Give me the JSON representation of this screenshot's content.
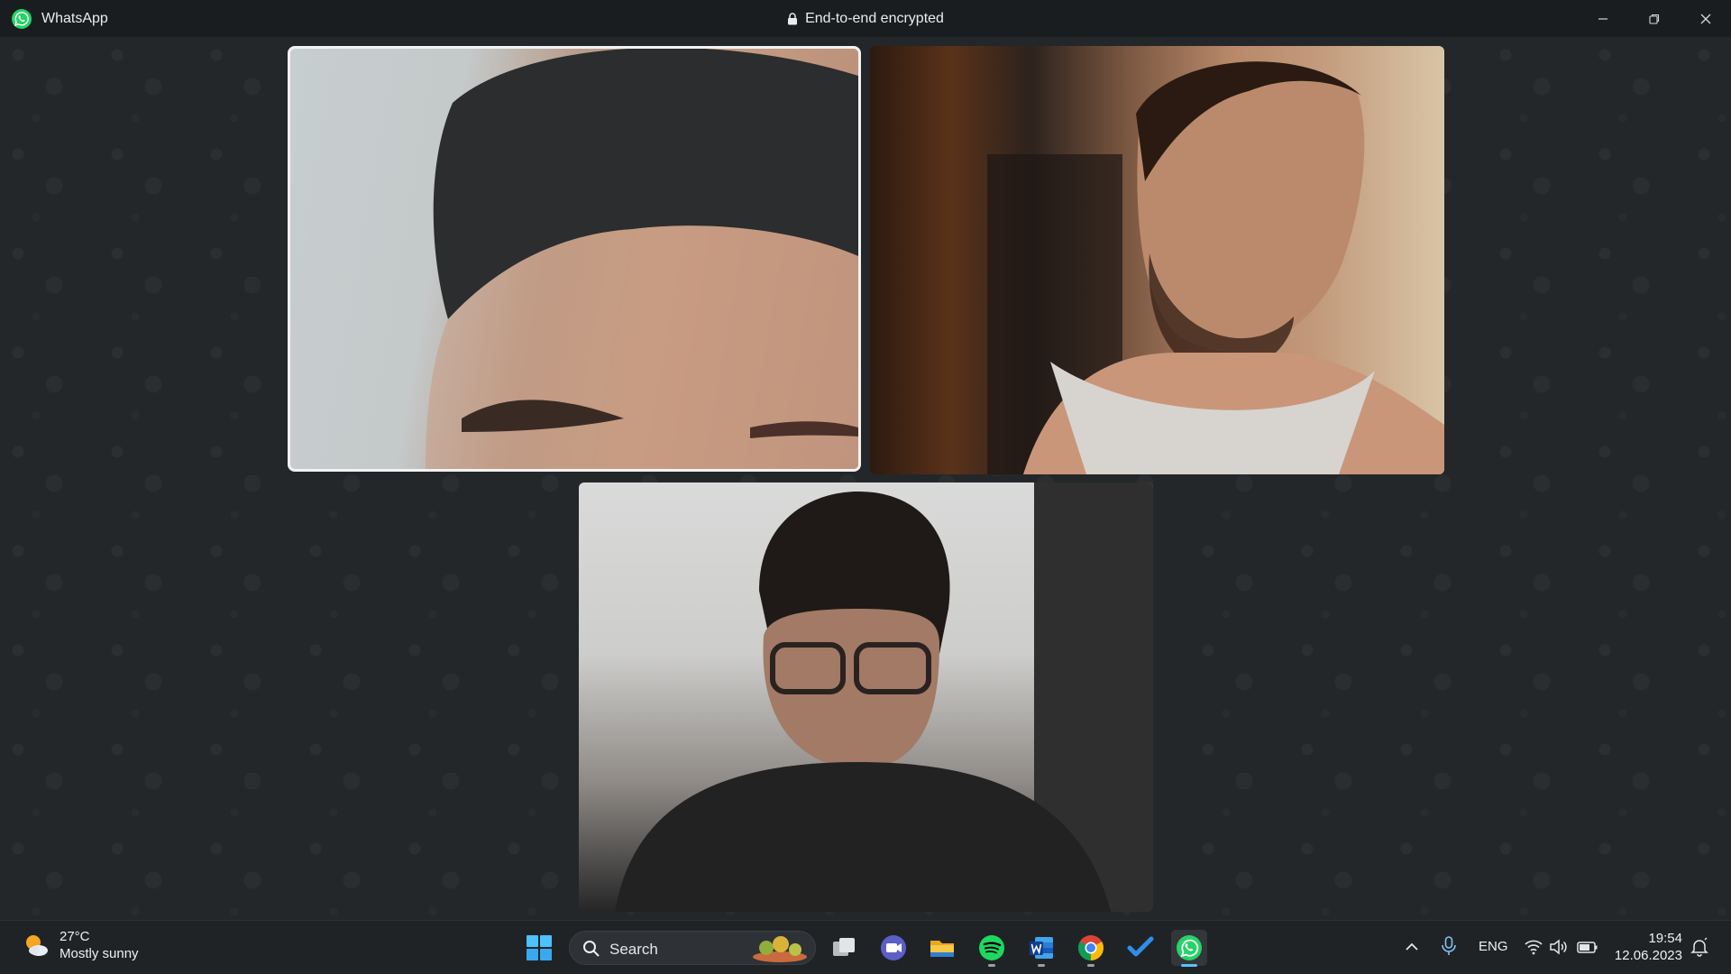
{
  "window": {
    "app_title": "WhatsApp",
    "encryption_label": "End-to-end encrypted",
    "icons": [
      "whatsapp-logo",
      "lock-icon",
      "minimize-icon",
      "restore-icon",
      "close-icon"
    ]
  },
  "call": {
    "participant_count": 3,
    "tiles": [
      {
        "description": "participant-video",
        "highlighted": true
      },
      {
        "description": "participant-video",
        "highlighted": false
      },
      {
        "description": "participant-video",
        "highlighted": false
      }
    ]
  },
  "taskbar": {
    "weather": {
      "temp": "27°C",
      "desc": "Mostly sunny"
    },
    "search_label": "Search",
    "apps": [
      "start",
      "task-view",
      "teams-meet",
      "file-explorer",
      "spotify",
      "word",
      "chrome",
      "todo",
      "whatsapp"
    ],
    "tray": {
      "language": "ENG",
      "time": "19:54",
      "date": "12.06.2023"
    }
  },
  "colors": {
    "titlebar": "#1a1d1f",
    "call_background": "#23272a",
    "taskbar": "#202326",
    "whatsapp_green": "#25d366",
    "accent_blue": "#5cc3f5"
  }
}
